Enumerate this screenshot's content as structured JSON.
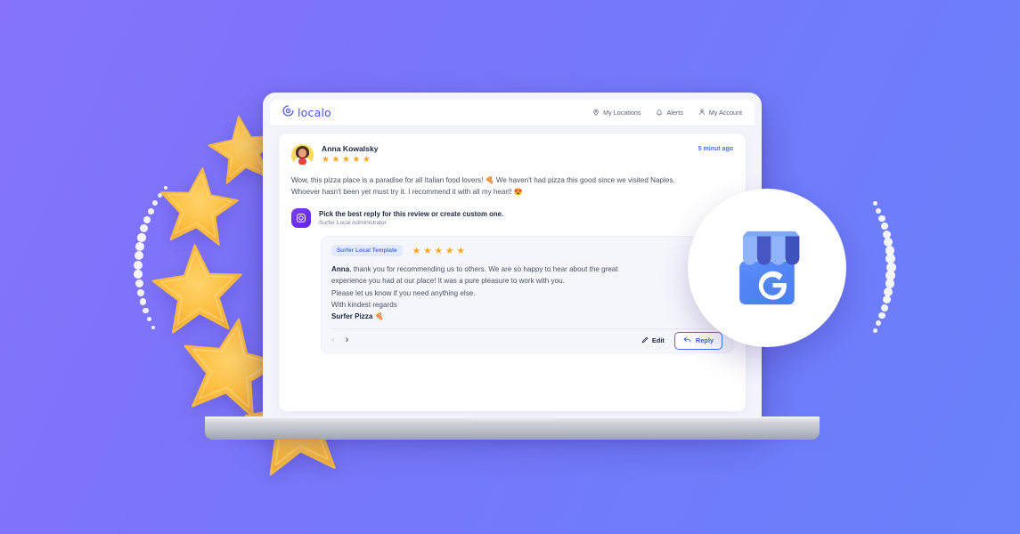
{
  "brand": {
    "logo_text": "localo",
    "logo_icon": "locao-spiral-icon",
    "accent_blue": "#4656e8",
    "link_blue": "#4b6ef5",
    "star_gold": "#f5a623",
    "purple": "#6124e8"
  },
  "background": {
    "gradient_from": "#8574fb",
    "gradient_to": "#6b80fb"
  },
  "nav": {
    "items": [
      {
        "label": "My Locations",
        "icon": "location-pin-icon"
      },
      {
        "label": "Alerts",
        "icon": "bell-icon"
      },
      {
        "label": "My Account",
        "icon": "person-icon"
      }
    ]
  },
  "review": {
    "author": "Anna Kowalsky",
    "rating": 5,
    "star_glyph": "★",
    "timestamp": "5 minut ago",
    "text": "Wow, this pizza place is a paradise for all Italian food lovers! 🍕 We haven't had pizza this good since we visited Naples. Whoever hasn't been yet must try it. I recommend it with all my heart! 😍"
  },
  "assistant": {
    "icon": "camera-aperture-icon",
    "title": "Pick the best reply for this review or create custom one.",
    "subtitle": "Surfer Local Administrator"
  },
  "template": {
    "badge": "Surfer Local Template",
    "rating": 5,
    "greeting_name": "Anna",
    "body": ", thank you for recommending us to others. We are so happy to hear about the great experience you had at our place! It was a pure pleasure to work with you.",
    "line_2": "Please let us know if you need anything else.",
    "line_3": "With kindest regards",
    "signature": "Surfer Pizza 🍕"
  },
  "actions": {
    "prev": {
      "label": "‹",
      "icon": "chevron-left-icon",
      "enabled": false
    },
    "next": {
      "label": "›",
      "icon": "chevron-right-icon",
      "enabled": true
    },
    "edit_label": "Edit",
    "edit_icon": "pencil-icon",
    "reply_label": "Reply",
    "reply_icon": "reply-arrow-icon"
  },
  "badge_graphic": {
    "name": "google-business-profile-icon",
    "letter": "G"
  }
}
